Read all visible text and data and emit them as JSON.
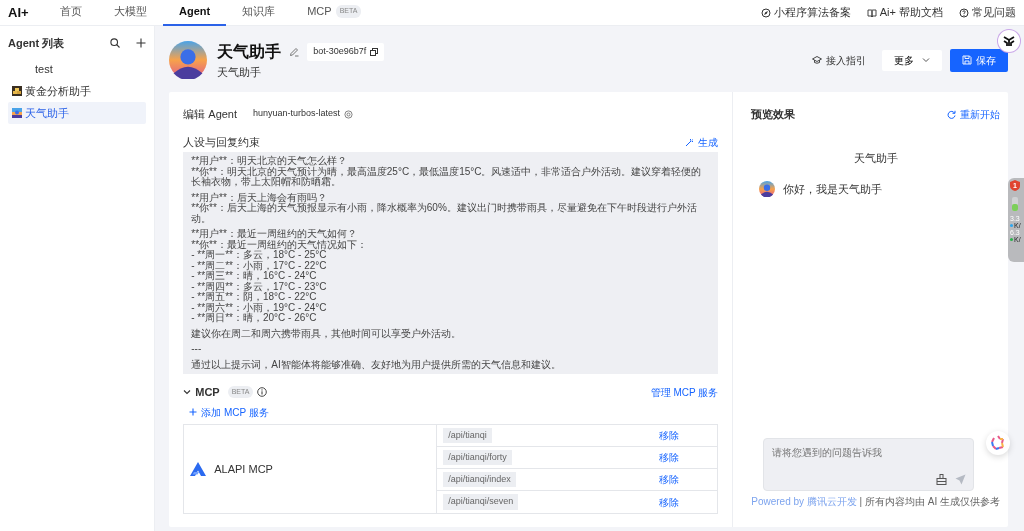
{
  "nav": {
    "logo": "AI+",
    "tabs": [
      {
        "label": "首页",
        "selected": false
      },
      {
        "label": "大模型",
        "selected": false
      },
      {
        "label": "Agent",
        "selected": true
      },
      {
        "label": "知识库",
        "selected": false
      },
      {
        "label": "MCP",
        "badge": "BETA",
        "selected": false
      }
    ],
    "links": [
      {
        "kind": "compass",
        "label": "小程序算法备案"
      },
      {
        "kind": "book",
        "label": "Ai+ 帮助文档"
      },
      {
        "kind": "help",
        "label": "常见问题"
      }
    ]
  },
  "sidebar": {
    "title": "Agent 列表",
    "items": [
      {
        "kind": "blank",
        "label": "test",
        "selected": false
      },
      {
        "kind": "gold",
        "label": "黄金分析助手",
        "selected": false
      },
      {
        "kind": "weather",
        "label": "天气助手",
        "selected": true
      }
    ]
  },
  "agent": {
    "name": "天气助手",
    "bot_id": "bot-30e96b7f",
    "description": "天气助手"
  },
  "actions": {
    "guide": "接入指引",
    "more": "更多",
    "save": "保存"
  },
  "editor": {
    "title": "编辑 Agent",
    "model": "hunyuan-turbos-latest",
    "prompt_label": "人设与回复约束",
    "generate": "生成",
    "prompt": [
      "**用户**：明天北京的天气怎么样？\n**你**：明天北京的天气预计为晴，最高温度25°C，最低温度15°C。风速适中，非常适合户外活动。建议穿着轻便的长袖衣物，带上太阳帽和防晒霜。",
      "**用户**：后天上海会有雨吗？\n**你**：后天上海的天气预报显示有小雨，降水概率为60%。建议出门时携带雨具，尽量避免在下午时段进行户外活动。",
      "**用户**：最近一周纽约的天气如何？\n**你**：最近一周纽约的天气情况如下：\n- **周一**：多云，18°C - 25°C\n- **周二**：小雨，17°C - 22°C\n- **周三**：晴，16°C - 24°C\n- **周四**：多云，17°C - 23°C\n- **周五**：阴，18°C - 22°C\n- **周六**：小雨，19°C - 24°C\n- **周日**：晴，20°C - 26°C",
      "建议你在周二和周六携带雨具，其他时间可以享受户外活动。",
      "---",
      "通过以上提示词，AI智能体将能够准确、友好地为用户提供所需的天气信息和建议。"
    ]
  },
  "mcp": {
    "title": "MCP",
    "badge": "BETA",
    "expanded": true,
    "manage": "管理 MCP 服务",
    "add": "添加 MCP 服务",
    "services": [
      {
        "name": "ALAPI MCP",
        "tools": [
          {
            "path": "/api/tianqi",
            "action": "移除"
          },
          {
            "path": "/api/tianqi/forty",
            "action": "移除"
          },
          {
            "path": "/api/tianqi/index",
            "action": "移除"
          },
          {
            "path": "/api/tianqi/seven",
            "action": "移除"
          }
        ]
      }
    ]
  },
  "preview": {
    "title": "预览效果",
    "restart": "重新开始",
    "bot_name": "天气助手",
    "messages": [
      {
        "text": "你好，我是天气助手"
      }
    ],
    "input": {
      "placeholder": "请将您遇到的问题告诉我"
    },
    "footer_link": "Powered by 腾讯云开发",
    "footer_note": "| 所有内容均由 AI 生成仅供参考"
  },
  "monitor": {
    "alerts": "1",
    "readings": [
      {
        "value": "3.3",
        "unit": "K/",
        "color": "#2ea8f0"
      },
      {
        "value": "6.3",
        "unit": "K/",
        "color": "#2bb24c"
      }
    ]
  }
}
